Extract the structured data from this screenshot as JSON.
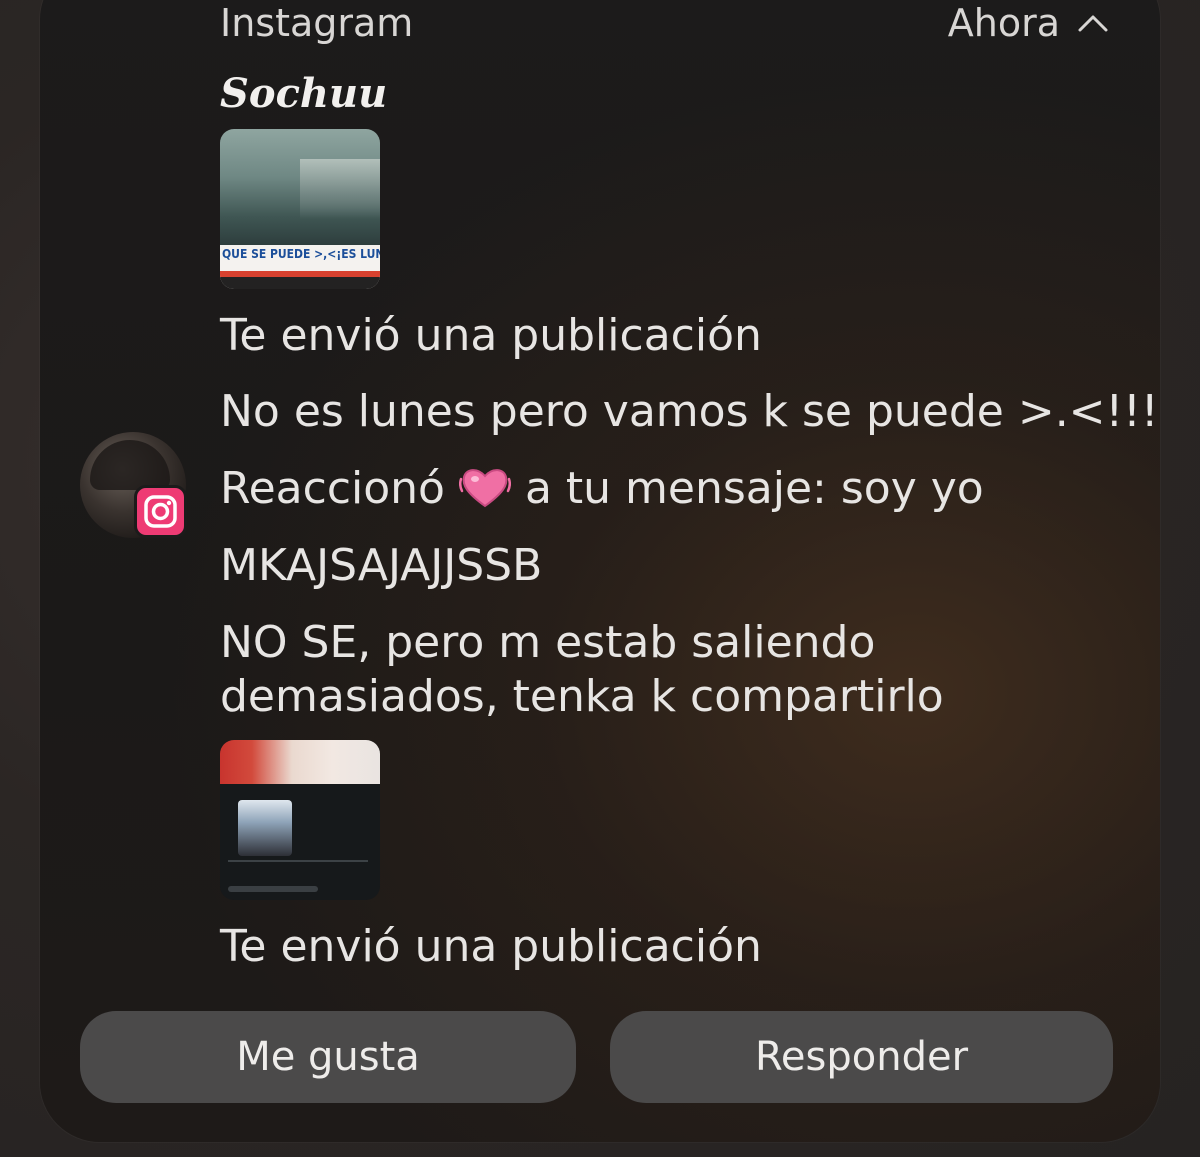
{
  "notification": {
    "app_name": "Instagram",
    "time": "Ahora",
    "collapse_icon": "chevron-up-icon",
    "sender": "Sochuu",
    "avatar_badge_icon": "instagram-icon",
    "badge_color": "#ee3b74",
    "messages": {
      "post_1_thumbnail_caption": "QUE SE PUEDE >,<¡ES LUN",
      "post_1_label": "Te envió una publicación",
      "msg_1": "No es lunes pero vamos k se puede >.<!!!",
      "reaction_prefix": "Reaccionó",
      "reaction_icon": "heart-icon",
      "reaction_suffix": "a tu mensaje: soy yo",
      "msg_2": "MKAJSAJAJJSSB",
      "msg_3": "NO SE, pero m estab saliendo demasiados, tenka k compartirlo",
      "post_2_label": "Te envió una publicación"
    },
    "actions": {
      "like_label": "Me gusta",
      "reply_label": "Responder"
    }
  }
}
